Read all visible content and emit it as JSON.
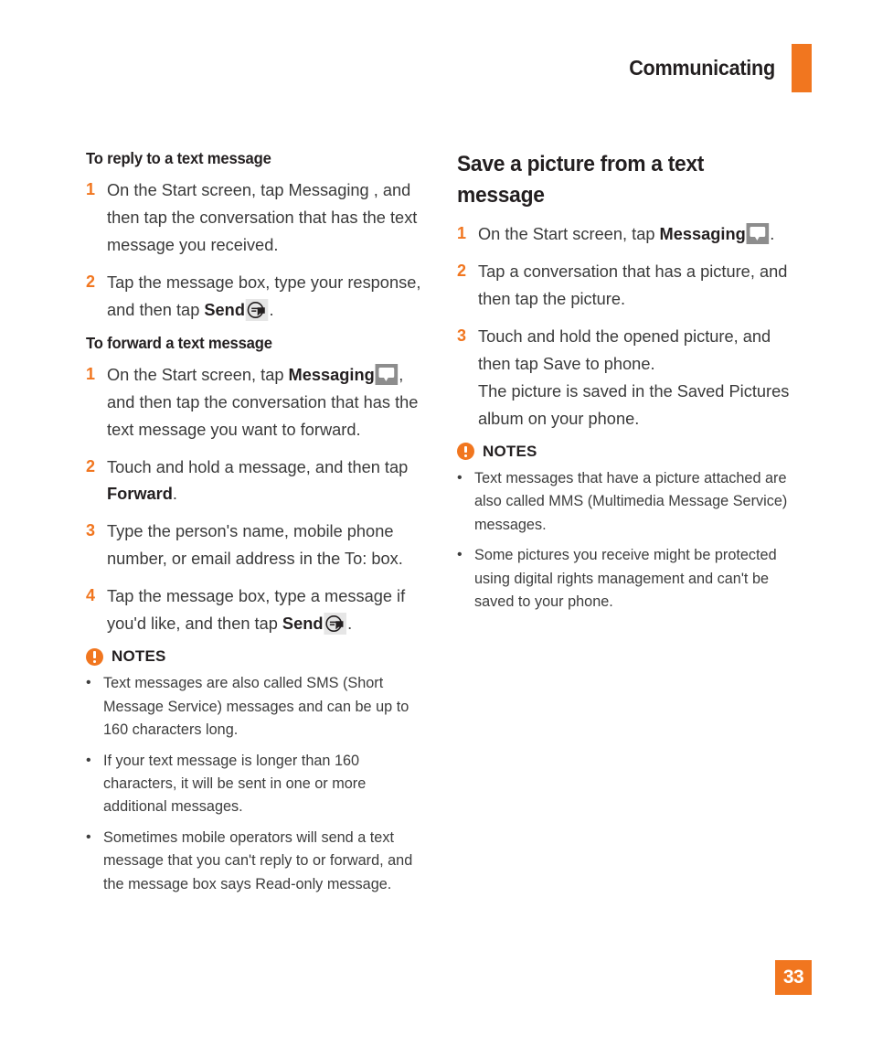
{
  "header": {
    "chapter_title": "Communicating",
    "accent_color": "#F1761F"
  },
  "left_column": {
    "section1": {
      "heading": "To reply to a text message",
      "steps": [
        {
          "number": "1",
          "text_before": "On the Start screen, tap Messaging , and then tap the conversation that has the text message you received.",
          "bold": "",
          "text_after": "",
          "icon": ""
        },
        {
          "number": "2",
          "text_before": "Tap the message box, type your response, and then tap ",
          "bold": "Send",
          "icon": "send-icon",
          "text_after": "."
        }
      ]
    },
    "section2": {
      "heading": "To forward a text message",
      "steps": [
        {
          "number": "1",
          "text_before": "On the Start screen, tap ",
          "bold": "Messaging",
          "icon": "messaging-icon",
          "text_after": ", and then tap the conversation that has the text message you want to forward."
        },
        {
          "number": "2",
          "text_before": "Touch and hold a message, and then tap ",
          "bold": "Forward",
          "icon": "",
          "text_after": "."
        },
        {
          "number": "3",
          "text_before": "Type the person's name, mobile phone number, or email address in the To: box.",
          "bold": "",
          "icon": "",
          "text_after": ""
        },
        {
          "number": "4",
          "text_before": "Tap the message box, type a message if you'd like, and then tap ",
          "bold": "Send",
          "icon": "send-icon",
          "text_after": "."
        }
      ]
    },
    "notes": {
      "label": "NOTES",
      "icon": "warning-icon",
      "items": [
        "Text messages are also called SMS (Short Message Service) messages and can be up to 160 characters long.",
        "If your text message is longer than 160 characters, it will be sent in one or more additional messages.",
        "Sometimes mobile operators will send a text message that you can't reply to or forward, and the message box says Read-only message."
      ]
    }
  },
  "right_column": {
    "section1": {
      "heading": "Save a picture from a text message",
      "steps": [
        {
          "number": "1",
          "text_before": "On the Start screen, tap ",
          "bold": "Messaging",
          "icon": "messaging-icon",
          "text_after": "."
        },
        {
          "number": "2",
          "text_before": "Tap a conversation that has a picture, and then tap the picture.",
          "bold": "",
          "icon": "",
          "text_after": ""
        },
        {
          "number": "3",
          "text_before": "Touch and hold the opened picture, and then tap Save to phone.",
          "bold": "",
          "icon": "",
          "text_after": "",
          "extra_line": "The picture is saved in the Saved Pictures album on your phone."
        }
      ]
    },
    "notes": {
      "label": "NOTES",
      "icon": "warning-icon",
      "items": [
        "Text messages that have a picture attached are also called MMS (Multimedia Message Service) messages.",
        "Some pictures you receive might be protected using digital rights management and can't be saved to your phone."
      ]
    }
  },
  "footer": {
    "page_number": "33"
  },
  "bullet_glyph": "•"
}
